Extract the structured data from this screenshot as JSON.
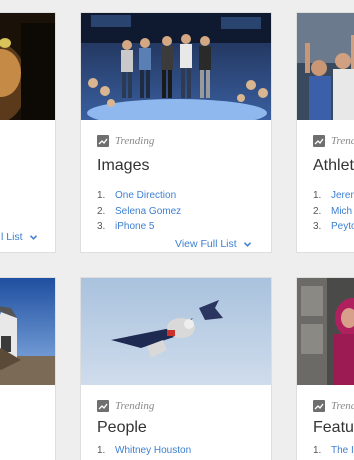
{
  "cards": {
    "left_top": {
      "view_full_label": "l List"
    },
    "images": {
      "trending_label": "Trending",
      "title": "Images",
      "items": [
        {
          "num": "1.",
          "label": "One Direction"
        },
        {
          "num": "2.",
          "label": "Selena Gomez"
        },
        {
          "num": "3.",
          "label": "iPhone 5"
        }
      ],
      "view_full_label": "View Full List"
    },
    "athletes": {
      "trending_label": "Trend",
      "title": "Athlet",
      "items": [
        {
          "num": "1.",
          "label": "Jeren"
        },
        {
          "num": "2.",
          "label": "Mich"
        },
        {
          "num": "3.",
          "label": "Peyto"
        }
      ]
    },
    "people": {
      "trending_label": "Trending",
      "title": "People",
      "items": [
        {
          "num": "1.",
          "label": "Whitney Houston"
        }
      ]
    },
    "featured": {
      "trending_label": "Trend",
      "title": "Featur",
      "items": [
        {
          "num": "1.",
          "label": "The I"
        }
      ]
    }
  },
  "colors": {
    "link": "#3d7fd1",
    "background": "#eeeeee",
    "card_border": "#dedede"
  }
}
